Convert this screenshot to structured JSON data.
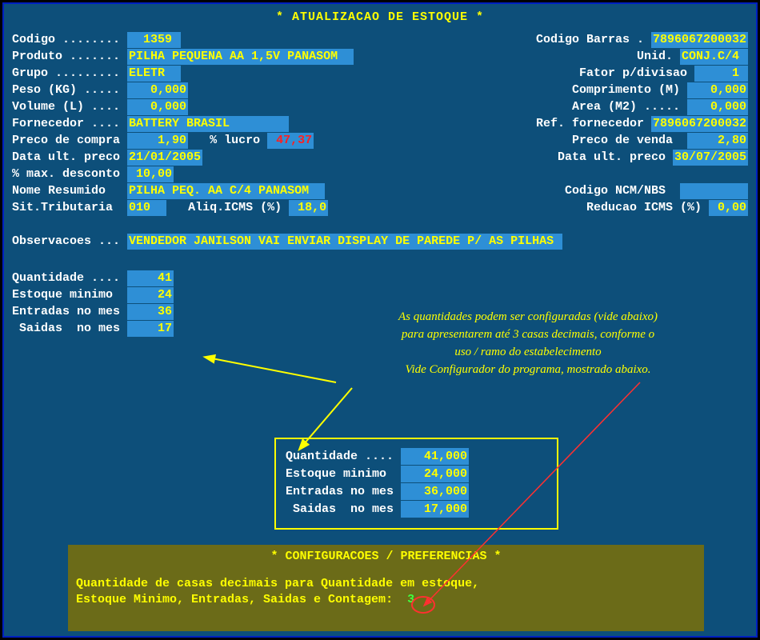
{
  "title": "* ATUALIZACAO DE ESTOQUE *",
  "labels": {
    "codigo": "Codigo ........ ",
    "codigo_barras": "Codigo Barras . ",
    "produto": "Produto ....... ",
    "unid": "Unid. ",
    "grupo": "Grupo ......... ",
    "fator": "Fator p/divisao ",
    "peso": "Peso (KG) ..... ",
    "comprimento": "Comprimento (M) ",
    "volume": "Volume (L) .... ",
    "area": "Area (M2) ..... ",
    "fornecedor": "Fornecedor .... ",
    "ref_forn": "Ref. fornecedor ",
    "preco_compra": "Preco de compra ",
    "lucro": "% lucro ",
    "preco_venda": "Preco de venda  ",
    "data_ult1": "Data ult. preco ",
    "data_ult2": "Data ult. preco ",
    "max_desc": "% max. desconto ",
    "nome_res": "Nome Resumido   ",
    "ncm": "Codigo NCM/NBS  ",
    "sit_trib": "Sit.Tributaria  ",
    "aliq": "Aliq.ICMS (%) ",
    "red_icms": "Reducao ICMS (%) ",
    "obs": "Observacoes ... ",
    "qtd": "Quantidade .... ",
    "est_min": "Estoque minimo  ",
    "entradas": "Entradas no mes ",
    "saidas": " Saidas  no mes "
  },
  "values": {
    "codigo": "  1359 ",
    "codigo_barras": "7896067200032",
    "produto": "PILHA PEQUENA AA 1,5V PANASOM  ",
    "unid": "CONJ.C/4 ",
    "grupo": "ELETR  ",
    "fator": "     1 ",
    "peso": "   0,000",
    "comprimento": "   0,000",
    "volume": "   0,000",
    "area": "   0,000",
    "fornecedor": "BATTERY BRASIL        ",
    "ref_forn": "7896067200032",
    "preco_compra": "    1,90",
    "lucro": " 47,37",
    "preco_venda": "    2,80",
    "data_ult1": "21/01/2005",
    "data_ult2": "30/07/2005",
    "max_desc": " 10,00",
    "nome_res": "PILHA PEQ. AA C/4 PANASOM  ",
    "ncm": "         ",
    "sit_trib": "010  ",
    "aliq": " 18,0",
    "red_icms": " 0,00",
    "obs": "VENDEDOR JANILSON VAI ENVIAR DISPLAY DE PAREDE P/ AS PILHAS ",
    "qtd": "    41",
    "est_min": "    24",
    "entradas": "    36",
    "saidas": "    17",
    "qtd_dec": "   41,000",
    "est_min_dec": "   24,000",
    "entradas_dec": "   36,000",
    "saidas_dec": "   17,000"
  },
  "annotation": {
    "line1": "As quantidades podem ser configuradas (vide abaixo)",
    "line2": "para apresentarem até 3 casas decimais, conforme o",
    "line3": "uso / ramo do estabelecimento",
    "line4": "Vide Configurador do programa, mostrado abaixo."
  },
  "config": {
    "title": "* CONFIGURACOES / PREFERENCIAS *",
    "line1": "Quantidade de casas decimais para Quantidade em estoque,",
    "line2": "Estoque Minimo, Entradas, Saidas e Contagem:  ",
    "value": "3"
  }
}
